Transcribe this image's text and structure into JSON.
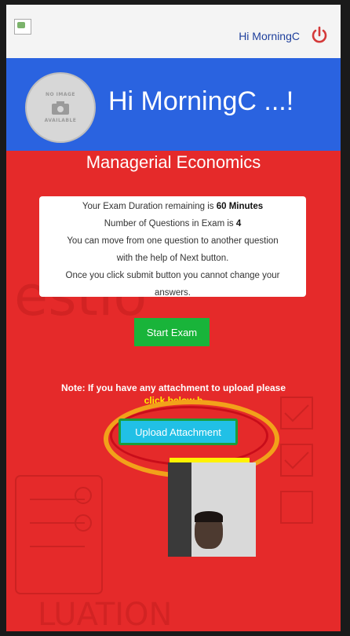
{
  "topbar": {
    "greeting": "Hi MorningC"
  },
  "hero": {
    "avatar_text_top": "NO IMAGE",
    "avatar_text_bottom": "AVAILABLE",
    "title": "Hi MorningC ...!"
  },
  "exam": {
    "subject": "Managerial Economics",
    "duration_prefix": "Your Exam Duration remaining is ",
    "duration_value": "60 Minutes",
    "questions_prefix": "Number of Questions in Exam is ",
    "questions_value": "4",
    "line3": "You can move from one question to another question",
    "line4": "with the help of Next button.",
    "line5": "Once you click submit button you cannot change your",
    "line6": "answers.",
    "start_label": "Start Exam"
  },
  "attachment": {
    "note": "Note: If you have any attachment to upload please",
    "note_tail": "click below b",
    "upload_label": "Upload Attachment"
  },
  "colors": {
    "page_red": "#e52a2a",
    "hero_blue": "#2a63e0",
    "start_green": "#19b43a",
    "upload_cyan": "#21c0e6"
  }
}
